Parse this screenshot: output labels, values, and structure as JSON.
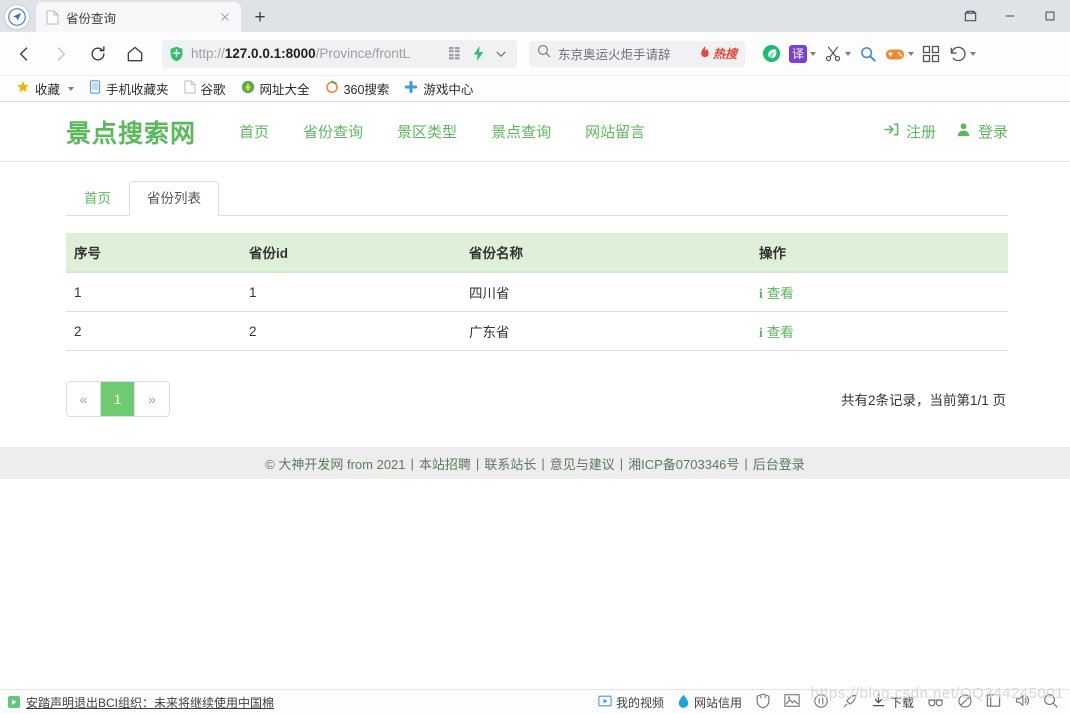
{
  "browser": {
    "tab": {
      "title": "省份查询",
      "favicon": "page-icon"
    },
    "newtab_label": "+",
    "window_controls": {
      "restore": "⛶",
      "minimize": "—",
      "maximize": "▢"
    },
    "toolbar": {
      "back": "back-arrow",
      "forward": "forward-arrow",
      "reload": "reload-icon",
      "home": "home-icon"
    },
    "omnibox": {
      "security_icon": "shield-icon",
      "url_prefix": "http://",
      "url_host": "127.0.0.1:8000",
      "url_path": "/Province/frontL",
      "url_full": "http://127.0.0.1:8000/Province/frontL",
      "qr_icon": "qrcode-icon",
      "lightning_icon": "lightning-icon",
      "chevron_icon": "chevron-down-icon"
    },
    "search": {
      "icon": "search-icon",
      "term": "东京奥运火炬手请辞",
      "hot_label": "热搜",
      "hot_icon": "flame-icon"
    },
    "tool_icons": [
      {
        "name": "leaf-icon",
        "label": ""
      },
      {
        "name": "translate-icon",
        "label": "译"
      },
      {
        "name": "scissors-icon",
        "label": ""
      },
      {
        "name": "magnifier-icon",
        "label": ""
      },
      {
        "name": "gamepad-icon",
        "label": ""
      },
      {
        "name": "apps-grid-icon",
        "label": ""
      },
      {
        "name": "undo-icon",
        "label": ""
      }
    ],
    "bookmarks": [
      {
        "label": "收藏",
        "icon": "star-icon",
        "has_caret": true
      },
      {
        "label": "手机收藏夹",
        "icon": "phone-icon",
        "has_caret": false
      },
      {
        "label": "谷歌",
        "icon": "page-icon",
        "has_caret": false
      },
      {
        "label": "网址大全",
        "icon": "hao360-icon",
        "has_caret": false
      },
      {
        "label": "360搜索",
        "icon": "360-icon",
        "has_caret": false
      },
      {
        "label": "游戏中心",
        "icon": "gamecenter-icon",
        "has_caret": false
      }
    ]
  },
  "site": {
    "logo": "景点搜索网",
    "nav": [
      {
        "label": "首页"
      },
      {
        "label": "省份查询"
      },
      {
        "label": "景区类型"
      },
      {
        "label": "景点查询"
      },
      {
        "label": "网站留言"
      }
    ],
    "auth": [
      {
        "label": "注册",
        "icon": "signin-arrow-icon"
      },
      {
        "label": "登录",
        "icon": "user-icon"
      }
    ]
  },
  "content": {
    "tabs": [
      {
        "label": "首页",
        "active": false
      },
      {
        "label": "省份列表",
        "active": true
      }
    ],
    "table": {
      "columns": [
        "序号",
        "省份id",
        "省份名称",
        "操作"
      ],
      "rows": [
        {
          "index": "1",
          "province_id": "1",
          "province_name": "四川省",
          "action": "查看",
          "action_icon": "info-icon"
        },
        {
          "index": "2",
          "province_id": "2",
          "province_name": "广东省",
          "action": "查看",
          "action_icon": "info-icon"
        }
      ]
    },
    "pagination": {
      "prev": "«",
      "pages": [
        {
          "label": "1",
          "current": true
        }
      ],
      "next": "»"
    },
    "record_info": "共有2条记录，当前第1/1 页"
  },
  "footer": {
    "copyright": "© 大神开发网 from 2021",
    "links": [
      "本站招聘",
      "联系站长",
      "意见与建议",
      "湘ICP备0703346号",
      "后台登录"
    ],
    "separator": "|"
  },
  "bottom_bar": {
    "news": {
      "icon": "news-icon",
      "text": "安踏声明退出BCI组织：未来将继续使用中国棉"
    },
    "tools": [
      {
        "name": "my-video",
        "label": "我的视频",
        "icon": "play-icon"
      },
      {
        "name": "site-credit",
        "label": "网站信用",
        "icon": "drop-icon"
      },
      {
        "name": "shield",
        "label": "",
        "icon": "shield-icon"
      },
      {
        "name": "screenshot",
        "label": "",
        "icon": "image-icon"
      },
      {
        "name": "mute",
        "label": "",
        "icon": "mute-icon"
      },
      {
        "name": "speed",
        "label": "",
        "icon": "rocket-icon"
      },
      {
        "name": "download",
        "label": "下载",
        "icon": "download-icon"
      },
      {
        "name": "incognito",
        "label": "",
        "icon": "glasses-icon"
      },
      {
        "name": "trace",
        "label": "",
        "icon": "trace-icon"
      },
      {
        "name": "sidebar",
        "label": "",
        "icon": "sidebar-icon"
      },
      {
        "name": "volume",
        "label": "",
        "icon": "volume-icon"
      },
      {
        "name": "zoom",
        "label": "",
        "icon": "zoom-icon"
      }
    ]
  },
  "watermark": "https://blog.csdn.net/QQ344245001",
  "colors": {
    "brand_green": "#5cb85c",
    "table_header_bg": "#dff0d8",
    "pagination_active": "#6ecb72",
    "footer_bg": "#ededed",
    "hot_red": "#e8453c"
  }
}
